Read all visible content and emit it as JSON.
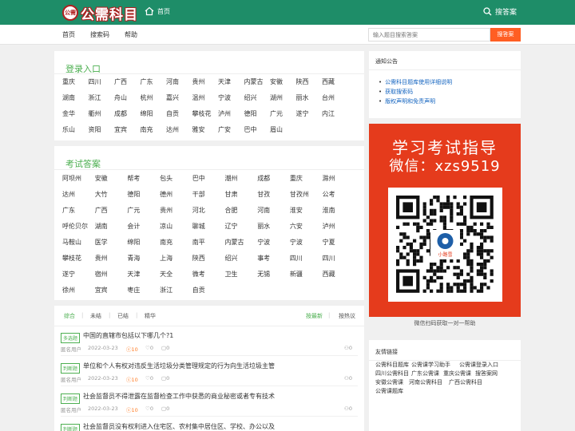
{
  "header": {
    "logo_badge": "公需",
    "logo_text": "公需科目",
    "home_label": "首页",
    "search_label": "搜答案"
  },
  "nav": {
    "items": [
      "首页",
      "搜索码",
      "帮助"
    ],
    "search_placeholder": "输入题目搜索答案",
    "search_button": "搜答案"
  },
  "login": {
    "title": "登录入口",
    "rows": [
      [
        "重庆",
        "四川",
        "广西",
        "广东",
        "河南",
        "贵州",
        "天津",
        "内蒙古",
        "安徽",
        "陕西",
        "西藏"
      ],
      [
        "湖南",
        "浙江",
        "舟山",
        "杭州",
        "嘉兴",
        "温州",
        "宁波",
        "绍兴",
        "湖州",
        "丽水",
        "台州"
      ],
      [
        "金华",
        "衢州",
        "成都",
        "绵阳",
        "自贡",
        "攀枝花",
        "泸州",
        "德阳",
        "广元",
        "遂宁",
        "内江"
      ],
      [
        "乐山",
        "资阳",
        "宜宾",
        "南充",
        "达州",
        "雅安",
        "广安",
        "巴中",
        "眉山"
      ]
    ]
  },
  "answers": {
    "title": "考试答案",
    "rows": [
      [
        "阿坝州",
        "安徽",
        "帮考",
        "包头",
        "巴中",
        "潮州",
        "成都",
        "重庆",
        "滁州"
      ],
      [
        "达州",
        "大竹",
        "德阳",
        "德州",
        "干部",
        "甘肃",
        "甘孜",
        "甘孜州",
        "公考"
      ],
      [
        "广东",
        "广西",
        "广元",
        "贵州",
        "河北",
        "合肥",
        "河南",
        "淮安",
        "淮南"
      ],
      [
        "呼伦贝尔",
        "湖南",
        "会计",
        "凉山",
        "聊城",
        "辽宁",
        "丽水",
        "六安",
        "泸州"
      ],
      [
        "马鞍山",
        "医学",
        "绵阳",
        "南充",
        "南平",
        "内蒙古",
        "宁波",
        "宁波",
        "宁夏"
      ],
      [
        "攀枝花",
        "贵州",
        "青海",
        "上海",
        "陕西",
        "绍兴",
        "事考",
        "四川",
        "四川"
      ],
      [
        "遂宁",
        "宿州",
        "天津",
        "天全",
        "微考",
        "卫生",
        "无锡",
        "新疆",
        "西藏"
      ],
      [
        "徐州",
        "宜宾",
        "枣庄",
        "浙江",
        "自贡"
      ]
    ]
  },
  "questions": {
    "tabs": [
      "综合",
      "未结",
      "已结",
      "精华"
    ],
    "sort_options": [
      "按最新",
      "按热议"
    ],
    "items": [
      {
        "badge": "多选题",
        "title": "中国的直辖市包括以下哪几个?1",
        "user": "匿名用户",
        "date": "2022-03-23",
        "views": "10",
        "likes": "0",
        "comments": "0",
        "answers": "0"
      },
      {
        "badge": "判断题",
        "title": "单位和个人有权对违反生活垃圾分类管理规定的行为向生活垃圾主管",
        "user": "匿名用户",
        "date": "2022-03-23",
        "views": "10",
        "likes": "0",
        "comments": "0",
        "answers": "0"
      },
      {
        "badge": "判断题",
        "title": "社会监督员不得泄露在监督检查工作中获悉的商业秘密或者专有技术",
        "user": "匿名用户",
        "date": "2022-03-23",
        "views": "10",
        "likes": "0",
        "comments": "0",
        "answers": "0"
      },
      {
        "badge": "判断题",
        "title": "社会监督员没有权利进入住宅区、农村集中居住区、学校、办公以及",
        "user": "",
        "date": "",
        "views": "",
        "likes": "",
        "comments": "",
        "answers": ""
      }
    ]
  },
  "notice": {
    "title": "通知公告",
    "items": [
      "公需科目题库使用详细说明",
      "获取搜索码",
      "版权声明和免责声明"
    ]
  },
  "ad": {
    "line1": "学习考试指导",
    "line2": "微信：xzs9519",
    "qr_logo_text": "小路雪",
    "caption": "微信扫码获取一对一帮助"
  },
  "friend_links": {
    "title": "友情链接",
    "rows": [
      [
        "公需科目题库",
        "公需课学习助手",
        "公需课登录入口"
      ],
      [
        "四川公需科目",
        "广东公需课",
        "重庆公需课",
        "搜答案网"
      ],
      [
        "安徽公需课",
        "河南公需科目",
        "广西公需科目"
      ],
      [
        "公需课题库"
      ]
    ]
  },
  "colors": {
    "header_bg": "#1e8d68",
    "accent_green": "#4caf50",
    "search_button": "#ff5e23",
    "ad_bg": "#e53b1c",
    "link_blue": "#1565c0"
  }
}
